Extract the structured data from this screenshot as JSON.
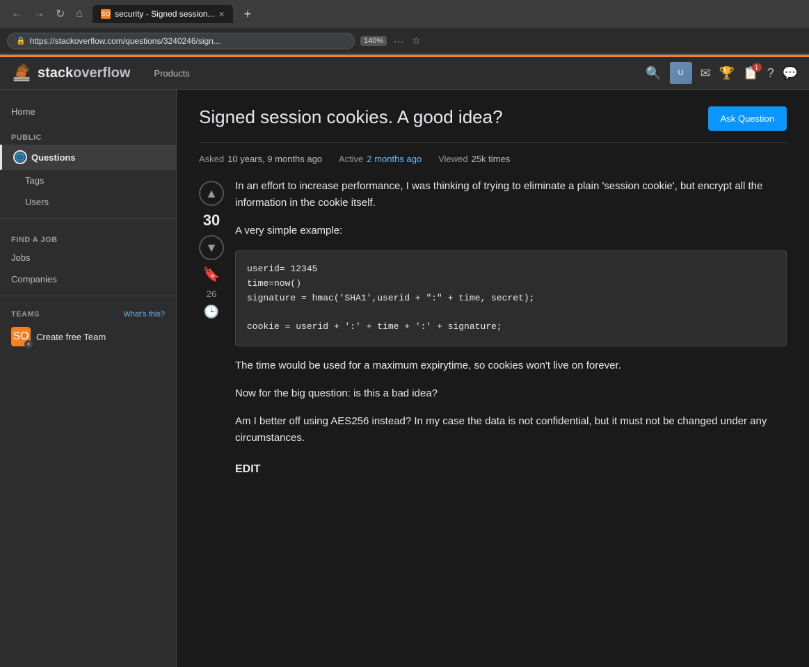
{
  "browser": {
    "tab_title": "security - Signed session...",
    "tab_close": "×",
    "new_tab": "+",
    "nav_back": "←",
    "nav_forward": "→",
    "nav_refresh": "↻",
    "nav_home": "⌂",
    "address": "https://stackoverflow.com/questions/3240246/sign...",
    "zoom": "140%",
    "more_btn": "···"
  },
  "header": {
    "logo_text_plain": "stack",
    "logo_text_bold": "overflow",
    "products_label": "Products"
  },
  "sidebar": {
    "home_label": "Home",
    "public_label": "PUBLIC",
    "questions_label": "Questions",
    "tags_label": "Tags",
    "users_label": "Users",
    "find_job_label": "FIND A JOB",
    "jobs_label": "Jobs",
    "companies_label": "Companies",
    "teams_label": "TEAMS",
    "whats_this": "What's this?",
    "create_team": "Create free Team"
  },
  "question": {
    "title": "Signed session cookies. A good idea?",
    "ask_button": "Ask Question",
    "asked_label": "Asked",
    "asked_value": "10 years, 9 months ago",
    "active_label": "Active",
    "active_value": "2 months ago",
    "viewed_label": "Viewed",
    "viewed_value": "25k times",
    "vote_count": "30",
    "bookmark_count": "26",
    "body_p1": "In an effort to increase performance, I was thinking of trying to eliminate a plain 'session cookie', but encrypt all the information in the cookie itself.",
    "body_p2": "A very simple example:",
    "code": "userid= 12345\ntime=now()\nsignature = hmac('SHA1',userid + \":\" + time, secret);\n\ncookie = userid + ':' + time + ':' + signature;",
    "body_p3": "The time would be used for a maximum expirytime, so cookies won't live on forever.",
    "body_p4": "Now for the big question: is this a bad idea?",
    "body_p5": "Am I better off using AES256 instead? In my case the data is not confidential, but it must not be changed under any circumstances.",
    "edit_label": "EDIT"
  }
}
